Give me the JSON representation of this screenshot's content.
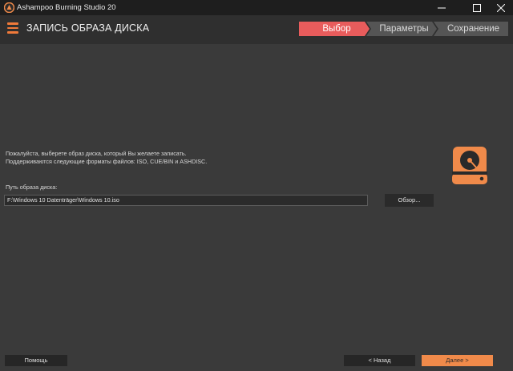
{
  "window": {
    "title": "Ashampoo Burning Studio 20",
    "controls": {
      "minimize": "—",
      "maximize": "□",
      "close": "✕"
    }
  },
  "header": {
    "title": "ЗАПИСЬ ОБРАЗА ДИСКА",
    "steps": [
      {
        "label": "Выбор",
        "active": true
      },
      {
        "label": "Параметры",
        "active": false
      },
      {
        "label": "Сохранение",
        "active": false
      }
    ]
  },
  "main": {
    "instruction_line1": "Пожалуйста, выберете образ диска, который Вы желаете записать.",
    "instruction_line2": "Поддерживаются следующие форматы файлов: ISO, CUE/BIN и ASHDISC.",
    "path_label": "Путь образа диска:",
    "path_value": "F:\\Windows 10 Datenträger\\Windows 10.iso",
    "browse_label": "Обзор..."
  },
  "footer": {
    "help_label": "Помощь",
    "back_label": "< Назад",
    "next_label": "Далее >"
  },
  "colors": {
    "accent_orange": "#f08a4a",
    "active_step": "#e85c5c",
    "background": "#3a3a3a"
  },
  "icons": [
    "app-logo-icon",
    "menu-hamburger-icon",
    "disk-drive-icon"
  ]
}
